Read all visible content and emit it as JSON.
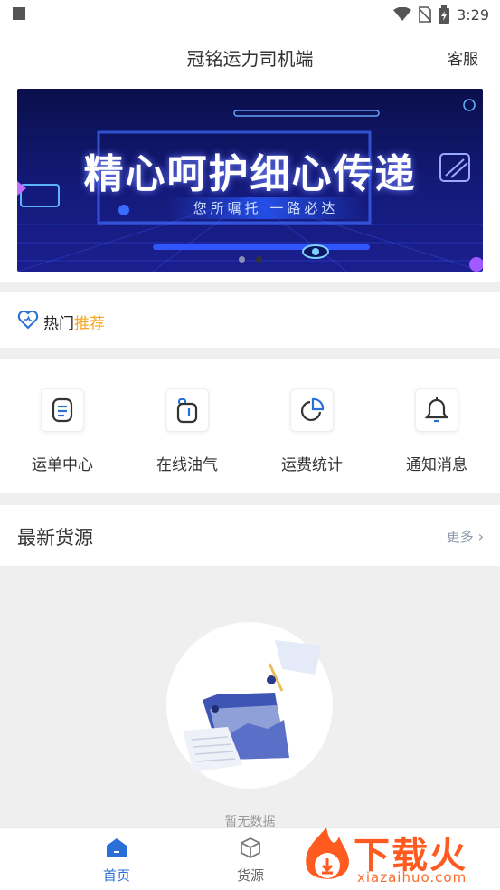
{
  "status_bar": {
    "time": "3:29"
  },
  "header": {
    "title": "冠铭运力司机端",
    "service_label": "客服"
  },
  "banner": {
    "title": "精心呵护细心传递",
    "subtitle": "您所嘱托  一路必达"
  },
  "hot": {
    "label_black": "热门",
    "label_orange": "推荐",
    "accent": "#f5a623"
  },
  "grid": {
    "items": [
      {
        "label": "运单中心",
        "icon": "document-list-icon"
      },
      {
        "label": "在线油气",
        "icon": "fuel-icon"
      },
      {
        "label": "运费统计",
        "icon": "pie-chart-icon"
      },
      {
        "label": "通知消息",
        "icon": "bell-icon"
      }
    ]
  },
  "latest": {
    "title": "最新货源",
    "more_label": "更多",
    "empty_text": "暂无数据"
  },
  "tabbar": {
    "tabs": [
      {
        "label": "首页",
        "icon": "home-icon",
        "active": true
      },
      {
        "label": "货源",
        "icon": "box-icon",
        "active": false
      }
    ],
    "accent": "#2a6fd6"
  },
  "watermark": {
    "text": "下载火",
    "url": "xiazaihuo.com"
  }
}
